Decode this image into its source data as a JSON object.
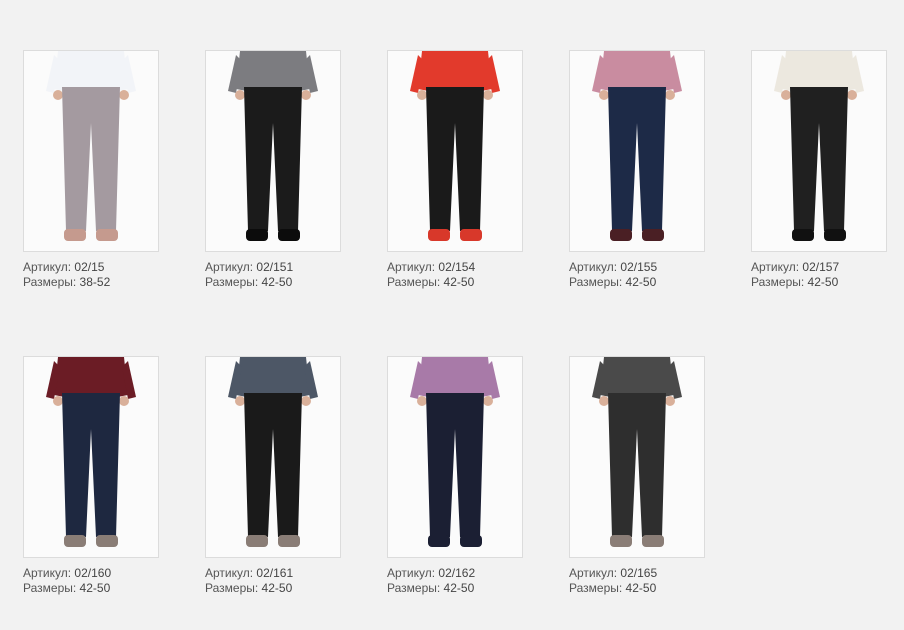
{
  "labels": {
    "article": "Артикул:",
    "sizes": "Размеры:"
  },
  "products": [
    {
      "article": "02/15",
      "sizes": "38-52",
      "image": "light-gray-harem-pants-photo",
      "pants_color": "#a49aa0",
      "top_color": "#f2f4f8",
      "shoe_color": "#c59a8e"
    },
    {
      "article": "02/151",
      "sizes": "42-50",
      "image": "black-wide-pants-photo",
      "pants_color": "#1b1b1b",
      "top_color": "#7c7c80",
      "shoe_color": "#0c0c0c"
    },
    {
      "article": "02/154",
      "sizes": "42-50",
      "image": "black-slim-pants-photo",
      "pants_color": "#1a1a1a",
      "top_color": "#e23a2c",
      "shoe_color": "#d8382a"
    },
    {
      "article": "02/155",
      "sizes": "42-50",
      "image": "dark-blue-jeans-photo",
      "pants_color": "#1d2a47",
      "top_color": "#c98ca0",
      "shoe_color": "#4a1f24"
    },
    {
      "article": "02/157",
      "sizes": "42-50",
      "image": "black-stitched-pants-photo",
      "pants_color": "#202020",
      "top_color": "#ece8df",
      "shoe_color": "#111111"
    },
    {
      "article": "02/160",
      "sizes": "42-50",
      "image": "navy-jeans-striped-top-photo",
      "pants_color": "#1e2840",
      "top_color": "#6b1c25",
      "shoe_color": "#8a7d76"
    },
    {
      "article": "02/161",
      "sizes": "42-50",
      "image": "black-coated-jeans-with-bag-photo",
      "pants_color": "#1a1a1a",
      "top_color": "#4d5766",
      "shoe_color": "#8a7d76"
    },
    {
      "article": "02/162",
      "sizes": "42-50",
      "image": "navy-pants-paisley-top-photo",
      "pants_color": "#1b1f33",
      "top_color": "#a87aa8",
      "shoe_color": "#1b1f33"
    },
    {
      "article": "02/165",
      "sizes": "42-50",
      "image": "charcoal-jeans-photo",
      "pants_color": "#2e2e2e",
      "top_color": "#4a4a4a",
      "shoe_color": "#8a7d76"
    }
  ]
}
